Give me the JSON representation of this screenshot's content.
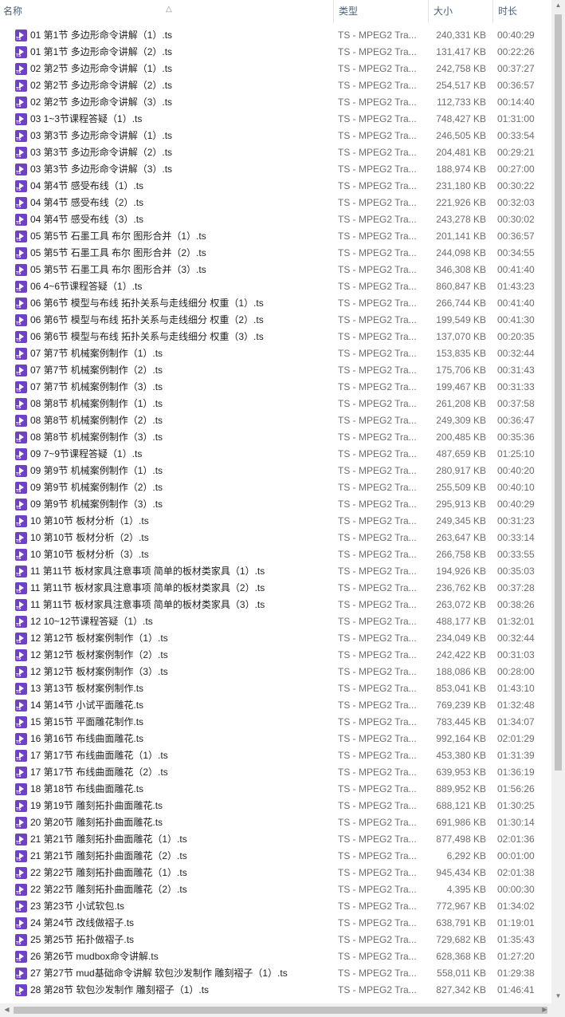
{
  "columns": {
    "name": "名称",
    "type": "类型",
    "size": "大小",
    "duration": "时长"
  },
  "icons": {
    "file": "ts-video-file-icon",
    "sort": "sort-up-icon"
  },
  "colors": {
    "file_icon": "#7040c8",
    "header_text": "#4c607a"
  },
  "files": [
    {
      "name": "01 第1节 多边形命令讲解（1）.ts",
      "type": "TS - MPEG2 Tra...",
      "size": "240,331 KB",
      "duration": "00:40:29"
    },
    {
      "name": "01 第1节 多边形命令讲解（2）.ts",
      "type": "TS - MPEG2 Tra...",
      "size": "131,417 KB",
      "duration": "00:22:26"
    },
    {
      "name": "02 第2节 多边形命令讲解（1）.ts",
      "type": "TS - MPEG2 Tra...",
      "size": "242,758 KB",
      "duration": "00:37:27"
    },
    {
      "name": "02 第2节 多边形命令讲解（2）.ts",
      "type": "TS - MPEG2 Tra...",
      "size": "254,517 KB",
      "duration": "00:36:57"
    },
    {
      "name": "02 第2节 多边形命令讲解（3）.ts",
      "type": "TS - MPEG2 Tra...",
      "size": "112,733 KB",
      "duration": "00:14:40"
    },
    {
      "name": "03 1~3节课程答疑（1）.ts",
      "type": "TS - MPEG2 Tra...",
      "size": "748,427 KB",
      "duration": "01:31:00"
    },
    {
      "name": "03 第3节 多边形命令讲解（1）.ts",
      "type": "TS - MPEG2 Tra...",
      "size": "246,505 KB",
      "duration": "00:33:54"
    },
    {
      "name": "03 第3节 多边形命令讲解（2）.ts",
      "type": "TS - MPEG2 Tra...",
      "size": "204,481 KB",
      "duration": "00:29:21"
    },
    {
      "name": "03 第3节 多边形命令讲解（3）.ts",
      "type": "TS - MPEG2 Tra...",
      "size": "188,974 KB",
      "duration": "00:27:00"
    },
    {
      "name": "04 第4节 感受布线（1）.ts",
      "type": "TS - MPEG2 Tra...",
      "size": "231,180 KB",
      "duration": "00:30:22"
    },
    {
      "name": "04 第4节 感受布线（2）.ts",
      "type": "TS - MPEG2 Tra...",
      "size": "221,926 KB",
      "duration": "00:32:03"
    },
    {
      "name": "04 第4节 感受布线（3）.ts",
      "type": "TS - MPEG2 Tra...",
      "size": "243,278 KB",
      "duration": "00:30:02"
    },
    {
      "name": "05 第5节 石墨工具  布尔  图形合并（1）.ts",
      "type": "TS - MPEG2 Tra...",
      "size": "201,141 KB",
      "duration": "00:36:57"
    },
    {
      "name": "05 第5节 石墨工具  布尔  图形合并（2）.ts",
      "type": "TS - MPEG2 Tra...",
      "size": "244,098 KB",
      "duration": "00:34:55"
    },
    {
      "name": "05 第5节 石墨工具  布尔  图形合并（3）.ts",
      "type": "TS - MPEG2 Tra...",
      "size": "346,308 KB",
      "duration": "00:41:40"
    },
    {
      "name": "06 4~6节课程答疑（1）.ts",
      "type": "TS - MPEG2 Tra...",
      "size": "860,847 KB",
      "duration": "01:43:23"
    },
    {
      "name": "06 第6节 模型与布线 拓扑关系与走线细分 权重（1）.ts",
      "type": "TS - MPEG2 Tra...",
      "size": "266,744 KB",
      "duration": "00:41:40"
    },
    {
      "name": "06 第6节 模型与布线 拓扑关系与走线细分 权重（2）.ts",
      "type": "TS - MPEG2 Tra...",
      "size": "199,549 KB",
      "duration": "00:41:30"
    },
    {
      "name": "06 第6节 模型与布线 拓扑关系与走线细分 权重（3）.ts",
      "type": "TS - MPEG2 Tra...",
      "size": "137,070 KB",
      "duration": "00:20:35"
    },
    {
      "name": "07 第7节 机械案例制作（1）.ts",
      "type": "TS - MPEG2 Tra...",
      "size": "153,835 KB",
      "duration": "00:32:44"
    },
    {
      "name": "07 第7节 机械案例制作（2）.ts",
      "type": "TS - MPEG2 Tra...",
      "size": "175,706 KB",
      "duration": "00:31:43"
    },
    {
      "name": "07 第7节 机械案例制作（3）.ts",
      "type": "TS - MPEG2 Tra...",
      "size": "199,467 KB",
      "duration": "00:31:33"
    },
    {
      "name": "08 第8节 机械案例制作（1）.ts",
      "type": "TS - MPEG2 Tra...",
      "size": "261,208 KB",
      "duration": "00:37:58"
    },
    {
      "name": "08 第8节 机械案例制作（2）.ts",
      "type": "TS - MPEG2 Tra...",
      "size": "249,309 KB",
      "duration": "00:36:47"
    },
    {
      "name": "08 第8节 机械案例制作（3）.ts",
      "type": "TS - MPEG2 Tra...",
      "size": "200,485 KB",
      "duration": "00:35:36"
    },
    {
      "name": "09 7~9节课程答疑（1）.ts",
      "type": "TS - MPEG2 Tra...",
      "size": "487,659 KB",
      "duration": "01:25:10"
    },
    {
      "name": "09 第9节 机械案例制作（1）.ts",
      "type": "TS - MPEG2 Tra...",
      "size": "280,917 KB",
      "duration": "00:40:20"
    },
    {
      "name": "09 第9节 机械案例制作（2）.ts",
      "type": "TS - MPEG2 Tra...",
      "size": "255,509 KB",
      "duration": "00:40:10"
    },
    {
      "name": "09 第9节 机械案例制作（3）.ts",
      "type": "TS - MPEG2 Tra...",
      "size": "295,913 KB",
      "duration": "00:40:29"
    },
    {
      "name": "10 第10节 板材分析（1）.ts",
      "type": "TS - MPEG2 Tra...",
      "size": "249,345 KB",
      "duration": "00:31:23"
    },
    {
      "name": "10 第10节 板材分析（2）.ts",
      "type": "TS - MPEG2 Tra...",
      "size": "263,647 KB",
      "duration": "00:33:14"
    },
    {
      "name": "10 第10节 板材分析（3）.ts",
      "type": "TS - MPEG2 Tra...",
      "size": "266,758 KB",
      "duration": "00:33:55"
    },
    {
      "name": "11 第11节 板材家具注意事项  简单的板材类家具（1）.ts",
      "type": "TS - MPEG2 Tra...",
      "size": "194,926 KB",
      "duration": "00:35:03"
    },
    {
      "name": "11 第11节 板材家具注意事项  简单的板材类家具（2）.ts",
      "type": "TS - MPEG2 Tra...",
      "size": "236,762 KB",
      "duration": "00:37:28"
    },
    {
      "name": "11 第11节 板材家具注意事项  简单的板材类家具（3）.ts",
      "type": "TS - MPEG2 Tra...",
      "size": "263,072 KB",
      "duration": "00:38:26"
    },
    {
      "name": "12 10~12节课程答疑（1）.ts",
      "type": "TS - MPEG2 Tra...",
      "size": "488,177 KB",
      "duration": "01:32:01"
    },
    {
      "name": "12 第12节 板材案例制作（1）.ts",
      "type": "TS - MPEG2 Tra...",
      "size": "234,049 KB",
      "duration": "00:32:44"
    },
    {
      "name": "12 第12节 板材案例制作（2）.ts",
      "type": "TS - MPEG2 Tra...",
      "size": "242,422 KB",
      "duration": "00:31:03"
    },
    {
      "name": "12 第12节 板材案例制作（3）.ts",
      "type": "TS - MPEG2 Tra...",
      "size": "188,086 KB",
      "duration": "00:28:00"
    },
    {
      "name": "13 第13节 板材案例制作.ts",
      "type": "TS - MPEG2 Tra...",
      "size": "853,041 KB",
      "duration": "01:43:10"
    },
    {
      "name": "14 第14节 小试平面雕花.ts",
      "type": "TS - MPEG2 Tra...",
      "size": "769,239 KB",
      "duration": "01:32:48"
    },
    {
      "name": "15 第15节 平面雕花制作.ts",
      "type": "TS - MPEG2 Tra...",
      "size": "783,445 KB",
      "duration": "01:34:07"
    },
    {
      "name": "16 第16节 布线曲面雕花.ts",
      "type": "TS - MPEG2 Tra...",
      "size": "992,164 KB",
      "duration": "02:01:29"
    },
    {
      "name": "17 第17节 布线曲面雕花（1）.ts",
      "type": "TS - MPEG2 Tra...",
      "size": "453,380 KB",
      "duration": "01:31:39"
    },
    {
      "name": "17 第17节 布线曲面雕花（2）.ts",
      "type": "TS - MPEG2 Tra...",
      "size": "639,953 KB",
      "duration": "01:36:19"
    },
    {
      "name": "18 第18节 布线曲面雕花.ts",
      "type": "TS - MPEG2 Tra...",
      "size": "889,952 KB",
      "duration": "01:56:26"
    },
    {
      "name": "19 第19节 雕刻拓扑曲面雕花.ts",
      "type": "TS - MPEG2 Tra...",
      "size": "688,121 KB",
      "duration": "01:30:25"
    },
    {
      "name": "20 第20节 雕刻拓扑曲面雕花.ts",
      "type": "TS - MPEG2 Tra...",
      "size": "691,986 KB",
      "duration": "01:30:14"
    },
    {
      "name": "21 第21节 雕刻拓扑曲面雕花（1）.ts",
      "type": "TS - MPEG2 Tra...",
      "size": "877,498 KB",
      "duration": "02:01:36"
    },
    {
      "name": "21 第21节 雕刻拓扑曲面雕花（2）.ts",
      "type": "TS - MPEG2 Tra...",
      "size": "6,292 KB",
      "duration": "00:01:00"
    },
    {
      "name": "22 第22节 雕刻拓扑曲面雕花（1）.ts",
      "type": "TS - MPEG2 Tra...",
      "size": "945,434 KB",
      "duration": "02:01:38"
    },
    {
      "name": "22 第22节 雕刻拓扑曲面雕花（2）.ts",
      "type": "TS - MPEG2 Tra...",
      "size": "4,395 KB",
      "duration": "00:00:30"
    },
    {
      "name": "23 第23节 小试软包.ts",
      "type": "TS - MPEG2 Tra...",
      "size": "772,967 KB",
      "duration": "01:34:02"
    },
    {
      "name": "24 第24节 改线做褶子.ts",
      "type": "TS - MPEG2 Tra...",
      "size": "638,791 KB",
      "duration": "01:19:01"
    },
    {
      "name": "25 第25节 拓扑做褶子.ts",
      "type": "TS - MPEG2 Tra...",
      "size": "729,682 KB",
      "duration": "01:35:43"
    },
    {
      "name": "26 第26节 mudbox命令讲解.ts",
      "type": "TS - MPEG2 Tra...",
      "size": "628,368 KB",
      "duration": "01:27:20"
    },
    {
      "name": "27 第27节 mud基础命令讲解  软包沙发制作  雕刻褶子（1）.ts",
      "type": "TS - MPEG2 Tra...",
      "size": "558,011 KB",
      "duration": "01:29:38"
    },
    {
      "name": "28 第28节 软包沙发制作  雕刻褶子（1）.ts",
      "type": "TS - MPEG2 Tra...",
      "size": "827,342 KB",
      "duration": "01:46:41"
    }
  ]
}
